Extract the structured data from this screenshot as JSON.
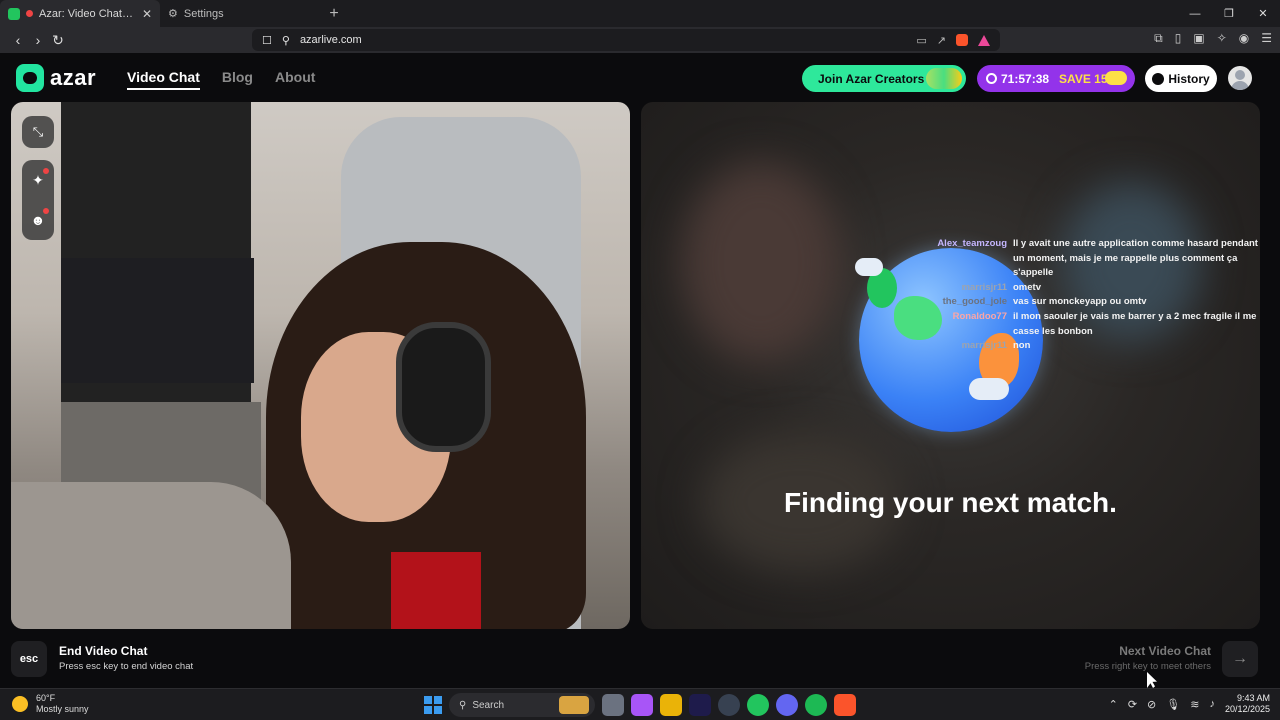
{
  "browser": {
    "tabs": [
      {
        "title": "Azar: Video Chat with New People",
        "active": true
      },
      {
        "title": "Settings",
        "active": false
      }
    ],
    "url": "azarlive.com"
  },
  "site": {
    "logo_text": "azar",
    "nav": [
      "Video Chat",
      "Blog",
      "About"
    ],
    "creators_label": "Join Azar Creators",
    "timer": "71:57:38",
    "save_label": "SAVE 15%",
    "history_label": "History"
  },
  "right_panel": {
    "status": "Finding your next match."
  },
  "chat": [
    {
      "user": "Alex_teamzoug",
      "color": "#c4b5fd",
      "message": "Il y avait une autre application comme hasard pendant un moment, mais je me rappelle plus comment ça s'appelle"
    },
    {
      "user": "marrisjr11",
      "color": "#9ca3af",
      "message": "ometv"
    },
    {
      "user": "the_good_jole",
      "color": "#6b7280",
      "message": "vas sur monckeyapp ou omtv"
    },
    {
      "user": "Ronaldoo77",
      "color": "#fca5a5",
      "message": "il mon saouler je vais me barrer y a 2 mec fragile il me casse les bonbon"
    },
    {
      "user": "marrisjr11",
      "color": "#9ca3af",
      "message": "non"
    }
  ],
  "bottom": {
    "esc_key": "esc",
    "end_title": "End Video Chat",
    "end_sub": "Press esc key to end video chat",
    "next_title": "Next Video Chat",
    "next_sub": "Press right key to meet others"
  },
  "taskbar": {
    "temperature": "60°F",
    "weather": "Mostly sunny",
    "search_label": "Search",
    "time": "9:43 AM",
    "date": "20/12/2025"
  }
}
